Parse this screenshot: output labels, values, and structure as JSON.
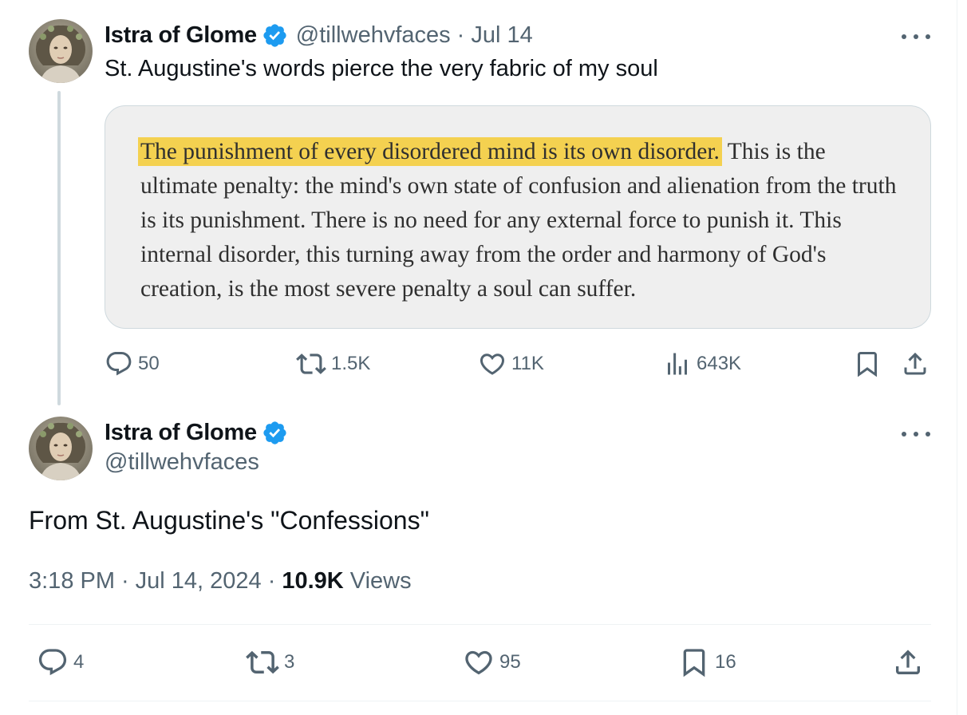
{
  "thread": {
    "parent": {
      "author": {
        "name": "Istra of Glome",
        "handle": "@tillwehvfaces",
        "verified_icon": "verified-badge-icon"
      },
      "date": "Jul 14",
      "separator": "·",
      "text": "St. Augustine's words pierce the very fabric of my soul",
      "quote_image": {
        "highlighted": "The punishment of every disordered mind is its own disorder.",
        "rest": " This is the ultimate penalty: the mind's own state of confusion and alienation from the truth is its punishment. There is no need for any external force to punish it. This internal disorder, this turning away from the order and harmony of God's creation, is the most severe penalty a soul can suffer.",
        "highlight_color": "#f4d150",
        "background_color": "#efefef"
      },
      "actions": {
        "replies": "50",
        "reposts": "1.5K",
        "likes": "11K",
        "views": "643K"
      }
    },
    "main": {
      "author": {
        "name": "Istra of Glome",
        "handle": "@tillwehvfaces"
      },
      "text": "From St. Augustine's \"Confessions\"",
      "time": "3:18 PM",
      "date": "Jul 14, 2024",
      "separator": "·",
      "views_count": "10.9K",
      "views_label": "Views",
      "actions": {
        "replies": "4",
        "reposts": "3",
        "likes": "95",
        "bookmarks": "16"
      }
    }
  },
  "colors": {
    "verified_blue": "#1d9bf0",
    "secondary_text": "#536471",
    "primary_text": "#0f1419",
    "thread_line": "#cfd9de"
  }
}
